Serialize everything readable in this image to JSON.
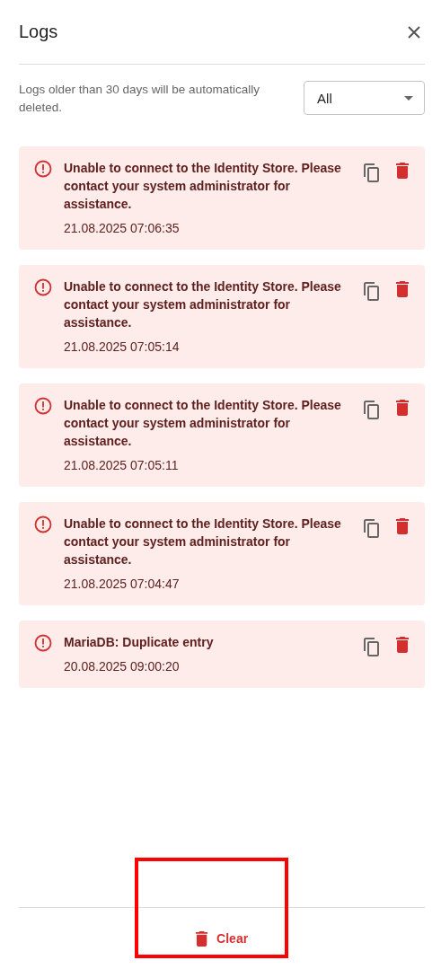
{
  "dialog": {
    "title": "Logs"
  },
  "notice": "Logs older than 30 days will be automatically deleted.",
  "filter": {
    "value": "All"
  },
  "logs": [
    {
      "message": "Unable to connect to the Identity Store. Please contact your system administrator for assistance.",
      "time": "21.08.2025 07:06:35"
    },
    {
      "message": "Unable to connect to the Identity Store. Please contact your system administrator for assistance.",
      "time": "21.08.2025 07:05:14"
    },
    {
      "message": "Unable to connect to the Identity Store. Please contact your system administrator for assistance.",
      "time": "21.08.2025 07:05:11"
    },
    {
      "message": "Unable to connect to the Identity Store. Please contact your system administrator for assistance.",
      "time": "21.08.2025 07:04:47"
    },
    {
      "message": "MariaDB: Duplicate entry",
      "time": "20.08.2025 09:00:20"
    }
  ],
  "clear_button": {
    "label": "Clear",
    "highlighted": true
  }
}
